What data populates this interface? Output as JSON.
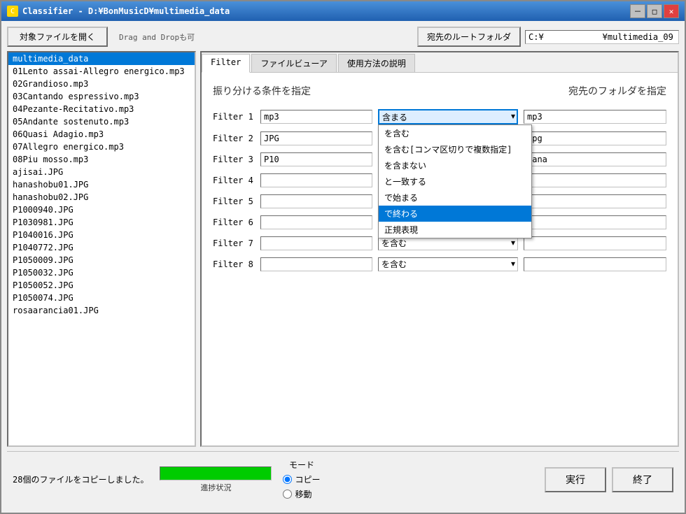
{
  "window": {
    "title": "Classifier - D:¥BonMusicD¥multimedia_data",
    "icon": "C"
  },
  "titleControls": {
    "minimize": "－",
    "maximize": "□",
    "close": "✕"
  },
  "topBar": {
    "openButton": "対象ファイルを開く",
    "dragLabel": "Drag and Dropも可",
    "destButton": "宛先のルートフォルダ",
    "destPath": "C:¥　　　　　　　¥multimedia_09"
  },
  "fileList": {
    "items": [
      {
        "label": "multimedia_data",
        "selected": true
      },
      {
        "label": "01Lento assai-Allegro energico.mp3",
        "selected": false
      },
      {
        "label": "02Grandioso.mp3",
        "selected": false
      },
      {
        "label": "03Cantando espressivo.mp3",
        "selected": false
      },
      {
        "label": "04Pezante-Recitativo.mp3",
        "selected": false
      },
      {
        "label": "05Andante sostenuto.mp3",
        "selected": false
      },
      {
        "label": "06Quasi Adagio.mp3",
        "selected": false
      },
      {
        "label": "07Allegro energico.mp3",
        "selected": false
      },
      {
        "label": "08Piu mosso.mp3",
        "selected": false
      },
      {
        "label": "ajisai.JPG",
        "selected": false
      },
      {
        "label": "hanashobu01.JPG",
        "selected": false
      },
      {
        "label": "hanashobu02.JPG",
        "selected": false
      },
      {
        "label": "P1000940.JPG",
        "selected": false
      },
      {
        "label": "P1030981.JPG",
        "selected": false
      },
      {
        "label": "P1040016.JPG",
        "selected": false
      },
      {
        "label": "P1040772.JPG",
        "selected": false
      },
      {
        "label": "P1050009.JPG",
        "selected": false
      },
      {
        "label": "P1050032.JPG",
        "selected": false
      },
      {
        "label": "P1050052.JPG",
        "selected": false
      },
      {
        "label": "P1050074.JPG",
        "selected": false
      },
      {
        "label": "rosaarancia01.JPG",
        "selected": false
      }
    ]
  },
  "tabs": [
    {
      "label": "Filter",
      "active": true
    },
    {
      "label": "ファイルビューア",
      "active": false
    },
    {
      "label": "使用方法の説明",
      "active": false
    }
  ],
  "filterPanel": {
    "mainTitle": "振り分ける条件を指定",
    "destTitle": "宛先のフォルダを指定",
    "filters": [
      {
        "id": "Filter 1",
        "value": "mp3",
        "condition": "含まる",
        "dest": "mp3",
        "dropdownOpen": true
      },
      {
        "id": "Filter 2",
        "value": "JPG",
        "condition": "を含む",
        "dest": "jpg",
        "dropdownOpen": false
      },
      {
        "id": "Filter 3",
        "value": "P10",
        "condition": "を含む",
        "dest": "pana",
        "dropdownOpen": false
      },
      {
        "id": "Filter 4",
        "value": "",
        "condition": "を含む",
        "dest": "",
        "dropdownOpen": false
      },
      {
        "id": "Filter 5",
        "value": "",
        "condition": "を含む",
        "dest": "",
        "dropdownOpen": false
      },
      {
        "id": "Filter 6",
        "value": "",
        "condition": "を含む",
        "dest": "",
        "dropdownOpen": false
      },
      {
        "id": "Filter 7",
        "value": "",
        "condition": "を含む",
        "dest": "",
        "dropdownOpen": false
      },
      {
        "id": "Filter 8",
        "value": "",
        "condition": "を含む",
        "dest": "",
        "dropdownOpen": false
      }
    ],
    "dropdownOptions": [
      {
        "label": "を含む",
        "highlighted": false
      },
      {
        "label": "を含む[コンマ区切りで複数指定]",
        "highlighted": false
      },
      {
        "label": "を含まない",
        "highlighted": false
      },
      {
        "label": "と一致する",
        "highlighted": false
      },
      {
        "label": "で始まる",
        "highlighted": false
      },
      {
        "label": "で終わる",
        "highlighted": true
      },
      {
        "label": "正規表現",
        "highlighted": false
      }
    ]
  },
  "bottomBar": {
    "statusText": "28個のファイルをコピーしました。",
    "progressLabel": "進捗状況",
    "progressPercent": 100,
    "modeLabel": "モード",
    "copyLabel": "コピー",
    "moveLabel": "移動",
    "executeButton": "実行",
    "exitButton": "終了"
  }
}
